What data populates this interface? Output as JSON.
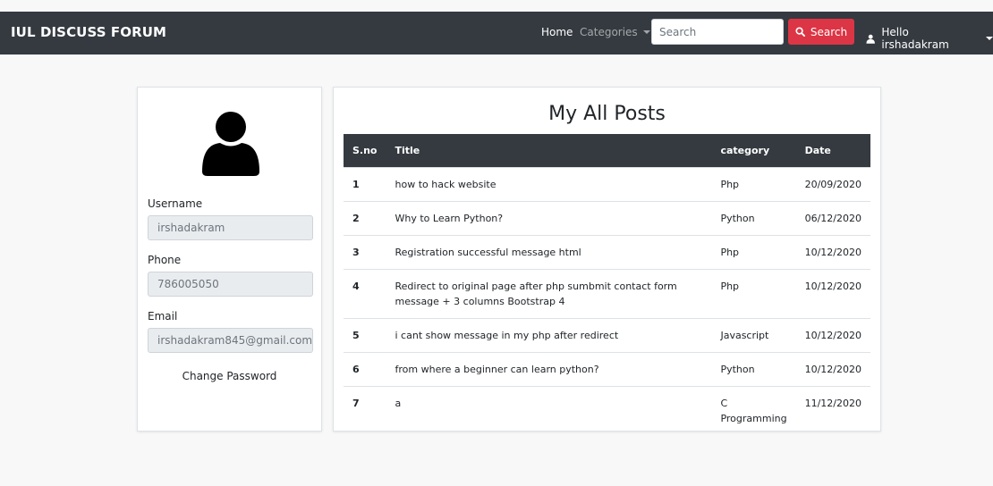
{
  "navbar": {
    "brand": "IUL DISCUSS FORUM",
    "home": "Home",
    "categories": "Categories",
    "search_placeholder": "Search",
    "search_button": "Search",
    "user_greeting": "Hello irshadakram",
    "accent_color": "#dc3545",
    "bar_color": "#343a40"
  },
  "profile": {
    "username_label": "Username",
    "username_value": "irshadakram",
    "phone_label": "Phone",
    "phone_value": "786005050",
    "email_label": "Email",
    "email_value": "irshadakram845@gmail.com",
    "change_password": "Change Password"
  },
  "posts": {
    "title": "My All Posts",
    "columns": [
      "S.no",
      "Title",
      "category",
      "Date"
    ],
    "rows": [
      {
        "sno": "1",
        "title": "how to hack website",
        "category": "Php",
        "date": "20/09/2020"
      },
      {
        "sno": "2",
        "title": "Why to Learn Python?",
        "category": "Python",
        "date": "06/12/2020"
      },
      {
        "sno": "3",
        "title": "Registration successful message html",
        "category": "Php",
        "date": "10/12/2020"
      },
      {
        "sno": "4",
        "title": "Redirect to original page after php sumbmit contact form message + 3 columns Bootstrap 4",
        "category": "Php",
        "date": "10/12/2020"
      },
      {
        "sno": "5",
        "title": "i cant show message in my php after redirect",
        "category": "Javascript",
        "date": "10/12/2020"
      },
      {
        "sno": "6",
        "title": "from where a beginner can learn python?",
        "category": "Python",
        "date": "10/12/2020"
      },
      {
        "sno": "7",
        "title": "a",
        "category": "C Programming",
        "date": "11/12/2020"
      }
    ]
  }
}
